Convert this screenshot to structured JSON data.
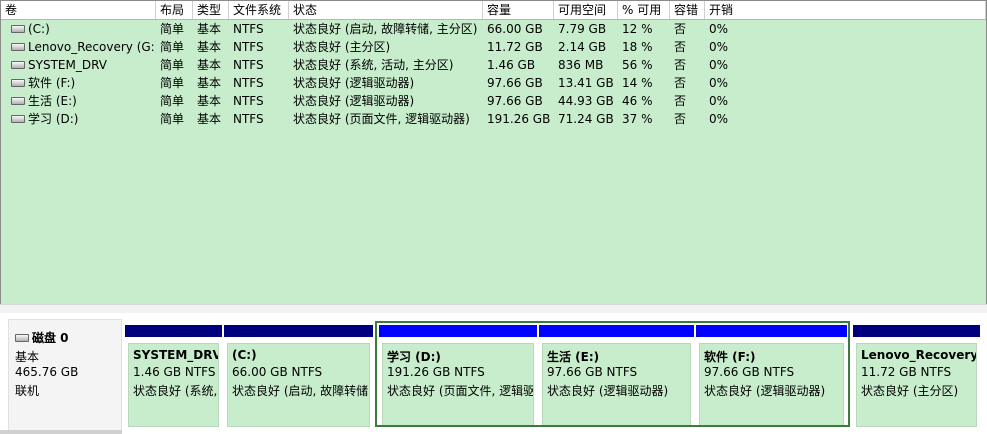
{
  "columns": [
    "卷",
    "布局",
    "类型",
    "文件系统",
    "状态",
    "容量",
    "可用空间",
    "% 可用",
    "容错",
    "开销"
  ],
  "volumes": [
    {
      "name": "(C:)",
      "layout": "简单",
      "type": "基本",
      "fs": "NTFS",
      "status": "状态良好 (启动, 故障转储, 主分区)",
      "capacity": "66.00 GB",
      "free": "7.79 GB",
      "pct": "12 %",
      "fault": "否",
      "overhead": "0%"
    },
    {
      "name": "Lenovo_Recovery (G:)",
      "layout": "简单",
      "type": "基本",
      "fs": "NTFS",
      "status": "状态良好 (主分区)",
      "capacity": "11.72 GB",
      "free": "2.14 GB",
      "pct": "18 %",
      "fault": "否",
      "overhead": "0%"
    },
    {
      "name": "SYSTEM_DRV",
      "layout": "简单",
      "type": "基本",
      "fs": "NTFS",
      "status": "状态良好 (系统, 活动, 主分区)",
      "capacity": "1.46 GB",
      "free": "836 MB",
      "pct": "56 %",
      "fault": "否",
      "overhead": "0%"
    },
    {
      "name": "软件 (F:)",
      "layout": "简单",
      "type": "基本",
      "fs": "NTFS",
      "status": "状态良好 (逻辑驱动器)",
      "capacity": "97.66 GB",
      "free": "13.41 GB",
      "pct": "14 %",
      "fault": "否",
      "overhead": "0%"
    },
    {
      "name": "生活 (E:)",
      "layout": "简单",
      "type": "基本",
      "fs": "NTFS",
      "status": "状态良好 (逻辑驱动器)",
      "capacity": "97.66 GB",
      "free": "44.93 GB",
      "pct": "46 %",
      "fault": "否",
      "overhead": "0%"
    },
    {
      "name": "学习 (D:)",
      "layout": "简单",
      "type": "基本",
      "fs": "NTFS",
      "status": "状态良好 (页面文件, 逻辑驱动器)",
      "capacity": "191.26 GB",
      "free": "71.24 GB",
      "pct": "37 %",
      "fault": "否",
      "overhead": "0%"
    }
  ],
  "disk": {
    "title": "磁盘 0",
    "type": "基本",
    "size": "465.76 GB",
    "state": "联机"
  },
  "partitions": [
    {
      "name": "SYSTEM_DRV",
      "size": "1.46 GB NTFS",
      "status": "状态良好 (系统, 活动, 主分区)",
      "bar": "#00007f"
    },
    {
      "name": "(C:)",
      "size": "66.00 GB NTFS",
      "status": "状态良好 (启动, 故障转储, 主分区)",
      "bar": "#00007f"
    },
    {
      "name": "学习  (D:)",
      "size": "191.26 GB NTFS",
      "status": "状态良好 (页面文件, 逻辑驱动器)",
      "bar": "#0000ff"
    },
    {
      "name": "生活  (E:)",
      "size": "97.66 GB NTFS",
      "status": "状态良好 (逻辑驱动器)",
      "bar": "#0000ff"
    },
    {
      "name": "软件  (F:)",
      "size": "97.66 GB NTFS",
      "status": "状态良好 (逻辑驱动器)",
      "bar": "#0000ff"
    },
    {
      "name": "Lenovo_Recovery",
      "size": "11.72 GB NTFS",
      "status": "状态良好 (主分区)",
      "bar": "#00007f"
    }
  ]
}
